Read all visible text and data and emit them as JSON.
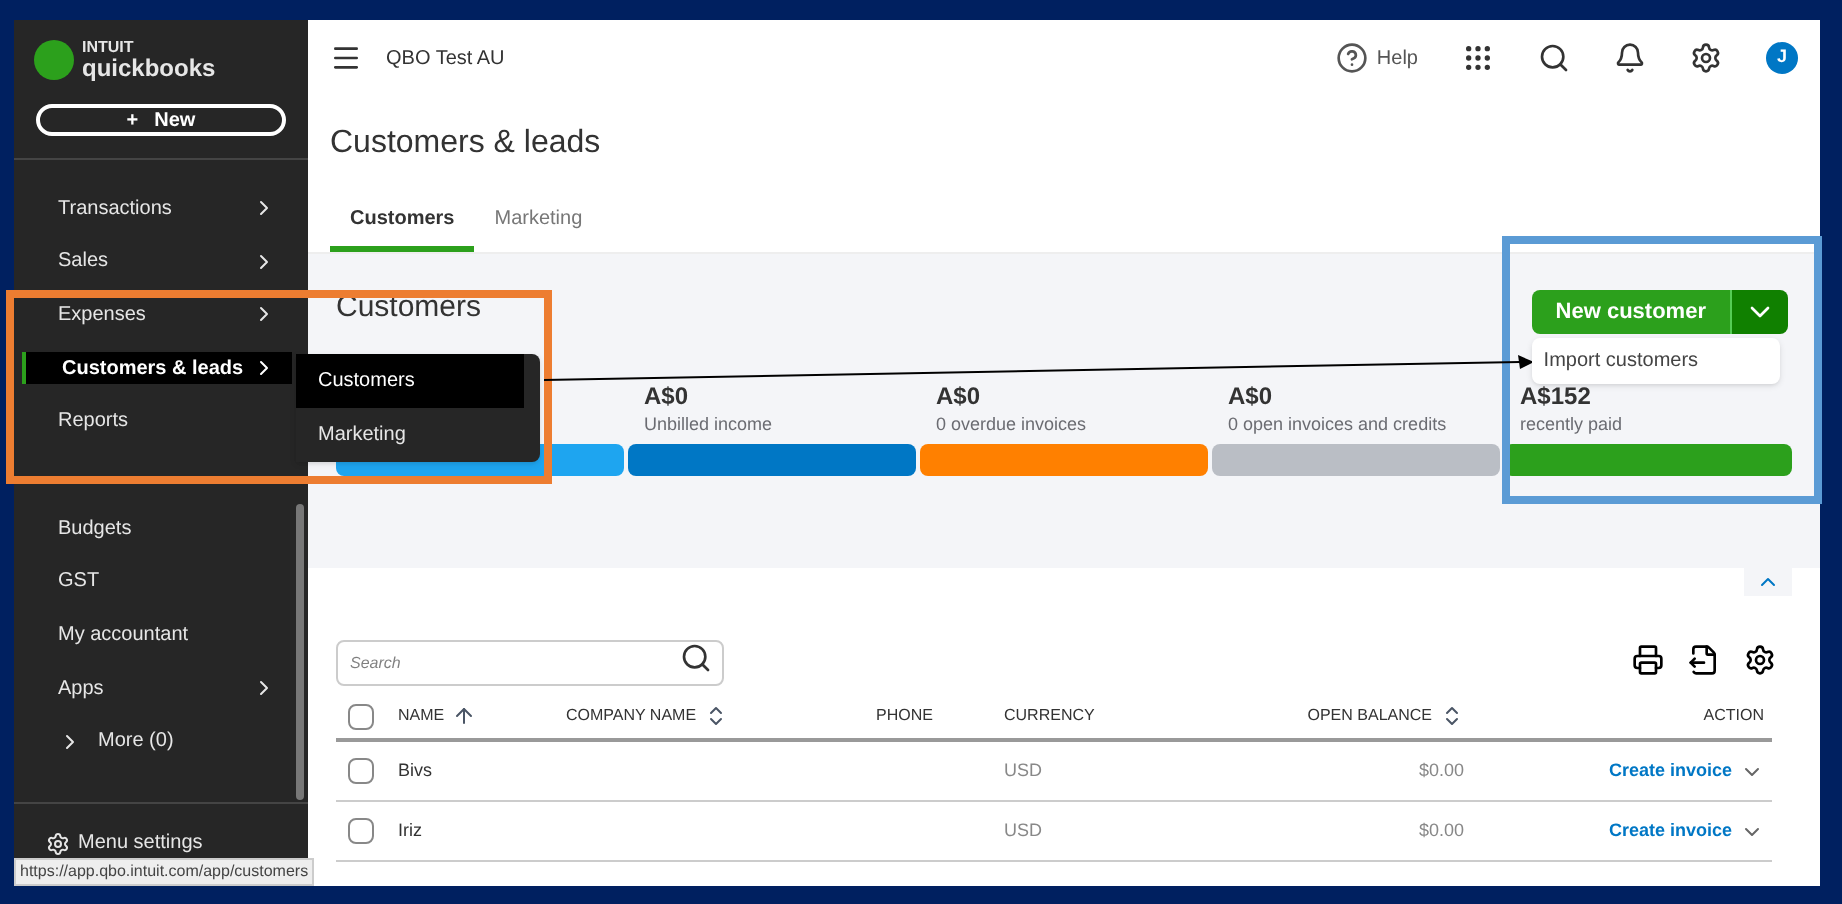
{
  "brand": {
    "top": "INTUIT",
    "name": "quickbooks"
  },
  "new_button": {
    "icon": "+",
    "label": "New"
  },
  "sidebar": {
    "items": [
      {
        "label": "Transactions",
        "chevron": true,
        "selected": false
      },
      {
        "label": "Sales",
        "chevron": true,
        "selected": false
      },
      {
        "label": "Expenses",
        "chevron": true,
        "selected": false
      },
      {
        "label": "Customers & leads",
        "chevron": true,
        "selected": true
      },
      {
        "label": "Reports",
        "chevron": false,
        "selected": false
      },
      {
        "label": "Budgets",
        "chevron": false,
        "selected": false
      },
      {
        "label": "GST",
        "chevron": false,
        "selected": false
      },
      {
        "label": "My accountant",
        "chevron": false,
        "selected": false
      },
      {
        "label": "Apps",
        "chevron": true,
        "selected": false
      }
    ],
    "more": "More (0)",
    "menu_settings": "Menu settings"
  },
  "submenu": [
    {
      "label": "Customers",
      "selected": true
    },
    {
      "label": "Marketing",
      "selected": false
    }
  ],
  "topbar": {
    "company": "QBO Test AU",
    "help": "Help",
    "avatar": "J"
  },
  "page": {
    "title": "Customers & leads",
    "tabs": [
      {
        "label": "Customers",
        "selected": true
      },
      {
        "label": "Marketing",
        "selected": false
      }
    ],
    "section_title": "Customers"
  },
  "new_customer": {
    "label": "New customer",
    "menu": [
      "Import customers"
    ]
  },
  "stats": [
    {
      "color": "#1ea5f0"
    },
    {
      "amount": "A$0",
      "label": "Unbilled income",
      "color": "#0077c5"
    },
    {
      "amount": "A$0",
      "label": "0 overdue invoices",
      "color": "#ff8000"
    },
    {
      "amount": "A$0",
      "label": "0 open invoices and credits",
      "color": "#babec5"
    },
    {
      "amount": "A$152",
      "label": "recently paid",
      "color": "#2ca01c"
    }
  ],
  "search": {
    "placeholder": "Search"
  },
  "table": {
    "header_checked": false,
    "columns": [
      {
        "label": "NAME",
        "sorted": true,
        "sortable": true
      },
      {
        "label": "COMPANY NAME",
        "sorted": false,
        "sortable": true
      },
      {
        "label": "PHONE",
        "sorted": false,
        "sortable": false
      },
      {
        "label": "CURRENCY",
        "sorted": false,
        "sortable": false
      },
      {
        "label": "OPEN BALANCE",
        "sorted": false,
        "sortable": true
      },
      {
        "label": "ACTION",
        "sorted": false,
        "sortable": false
      }
    ],
    "rows": [
      {
        "name": "Bivs",
        "currency": "USD",
        "balance": "$0.00",
        "action": "Create invoice",
        "checked": false
      },
      {
        "name": "Iriz",
        "currency": "USD",
        "balance": "$0.00",
        "action": "Create invoice",
        "checked": false
      }
    ]
  },
  "status_url": "https://app.qbo.intuit.com/app/customers"
}
